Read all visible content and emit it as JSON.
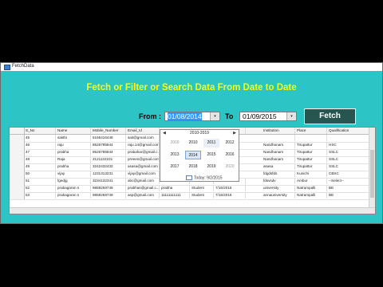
{
  "window": {
    "title": "FetchData"
  },
  "heading": "Fetch or Filter or Search Data From Date to Date",
  "from": {
    "label": "From :",
    "value": "01/08/2014"
  },
  "to": {
    "label": "To",
    "value": "01/09/2015"
  },
  "fetch_label": "Fetch",
  "grid": {
    "columns": [
      "S_No",
      "Name",
      "Mobile_Number",
      "Email_Id",
      "Po",
      "",
      "Institution",
      "Place",
      "Qualification"
    ],
    "rows": [
      [
        "45",
        "sakthi",
        "5165416448",
        "sait@gmail.com",
        "123",
        "",
        "",
        "",
        ""
      ],
      [
        "46",
        "raju",
        "8526785844",
        "raju.14@gmail.com",
        "123",
        "",
        "Nandhanam",
        "Tirupattur",
        "HSC"
      ],
      [
        "47",
        "prabha",
        "8526785844",
        "prabahar@gmail.c...",
        "123",
        "",
        "Nandhanam",
        "Tirupattur",
        "SSLC"
      ],
      [
        "48",
        "Raja",
        "2121122221",
        "preeen@gmail.com",
        "123",
        "",
        "Nandhanam",
        "Tirupattur",
        "SSLC"
      ],
      [
        "49",
        "prabha",
        "3242432432",
        "asasa@gmail.com",
        "123",
        "",
        "asasa",
        "Tirupattur",
        "SSLC"
      ],
      [
        "50",
        "vijay",
        "1231313231",
        "vijay@gmail.com",
        "vijay",
        "",
        "fdgdsfds",
        "Kunichi",
        "CBSC"
      ],
      [
        "51",
        "fgedjg",
        "3234132341",
        "abc@gmail.com",
        "dhdr",
        "7/15/2015",
        "fdsvsdv",
        "Ambur",
        "--Select--"
      ],
      [
        "52",
        "prabagaran s",
        "9859259749",
        "prabhas@gmail.c...",
        "prabha",
        "7/15/2015",
        "university",
        "Natrampalli",
        "BE"
      ],
      [
        "53",
        "prabagaran s",
        "9859259749",
        "asp@gmail.com",
        "11111111111",
        "7/15/2015",
        "annauniversity",
        "Natrampalli",
        "BE"
      ]
    ],
    "partial_cells": {
      "col5_rows_6_8": "Student"
    }
  },
  "calendar": {
    "decade_title": "2010-2019",
    "years": [
      "2009",
      "2010",
      "2011",
      "2012",
      "2013",
      "2014",
      "2015",
      "2016",
      "2017",
      "2018",
      "2019",
      "2020"
    ],
    "current": "2014",
    "today_label": "Today: 9/2/2015"
  }
}
